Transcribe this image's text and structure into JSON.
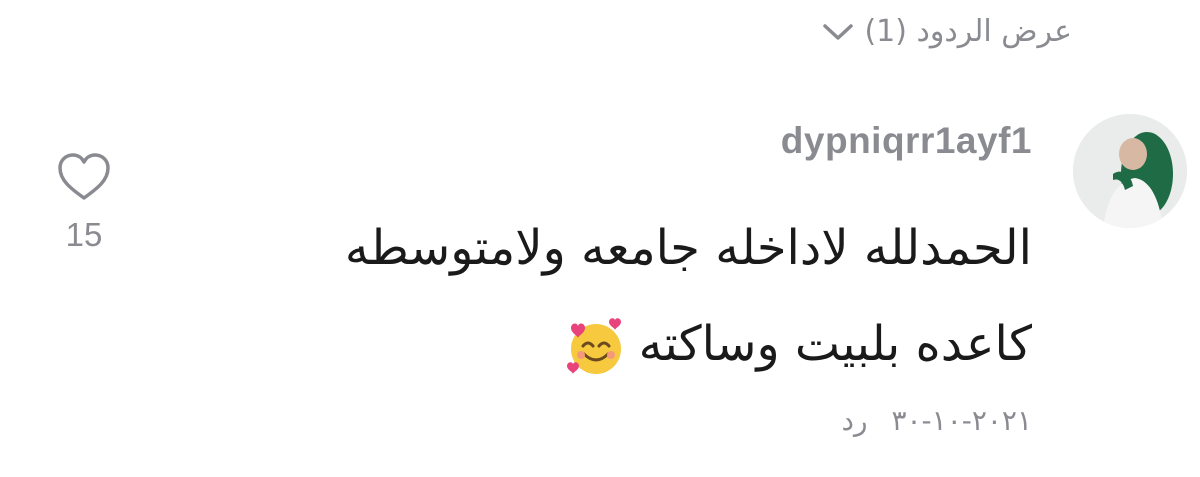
{
  "replies": {
    "label": "عرض الردود (1)",
    "icon": "chevron-down-icon"
  },
  "comment": {
    "username": "dypniqrr1ayf1",
    "line1": "الحمدلله لاداخله جامعه ولامتوسطه",
    "line2": "كاعده بلبيت وساكته",
    "emoji": "smiling-face-with-hearts-icon",
    "date": "٢٠٢١-١٠-٣٠",
    "reply_label": "رد"
  },
  "like": {
    "icon": "heart-outline-icon",
    "count": "15"
  },
  "colors": {
    "muted_text": "#8a8b91",
    "text": "#1a1a1a",
    "background": "#ffffff"
  }
}
